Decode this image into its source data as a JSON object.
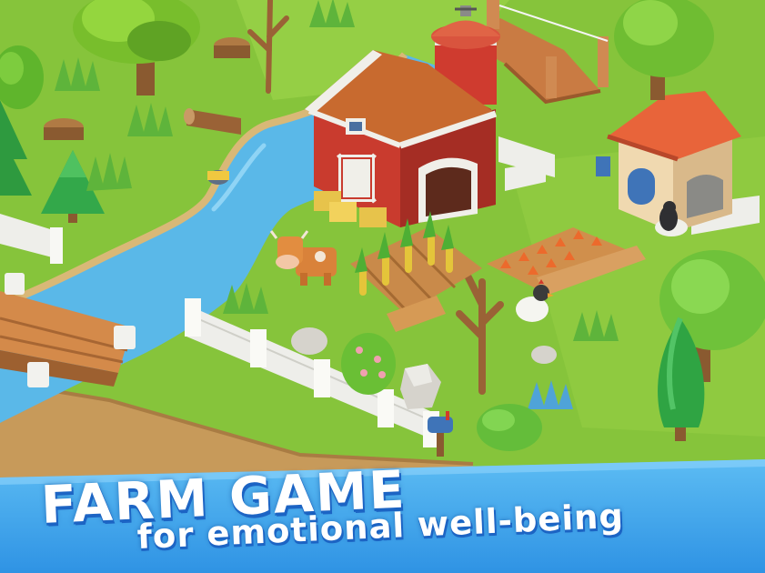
{
  "promo": {
    "headline": "FARM GAME",
    "tagline": "for emotional well-being"
  },
  "scene": {
    "objects": [
      "barn",
      "silo",
      "cottage",
      "cow",
      "penguin-bird",
      "chicken",
      "corn-field",
      "carrot-field",
      "river",
      "wooden-bridge",
      "trees",
      "fence",
      "rocks",
      "hay-bales",
      "mailbox"
    ]
  },
  "colors": {
    "grass": "#86c43b",
    "river": "#5ab8e8",
    "banner": "#39a6ec",
    "text": "#ffffff",
    "text_shadow": "#1c64c4"
  }
}
